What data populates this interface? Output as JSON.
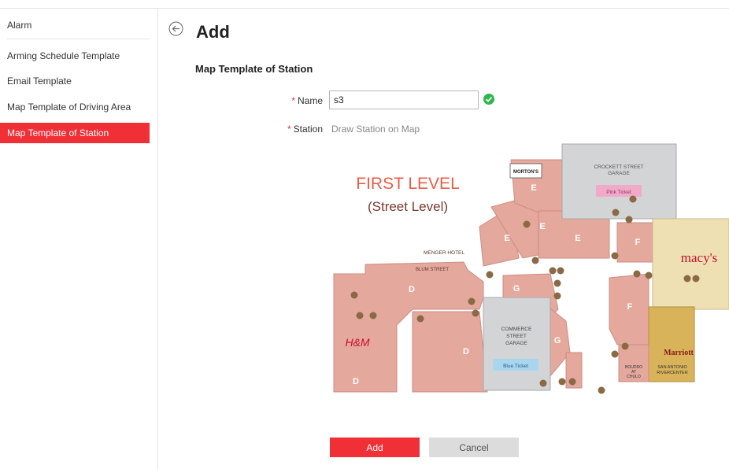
{
  "sidebar": {
    "title": "Alarm",
    "items": [
      {
        "label": "Arming Schedule Template"
      },
      {
        "label": "Email Template"
      },
      {
        "label": "Map Template of Driving Area"
      },
      {
        "label": "Map Template of Station",
        "active": true
      }
    ]
  },
  "header": {
    "title": "Add",
    "back_icon": "back-arrow-icon"
  },
  "form": {
    "section_title": "Map Template of Station",
    "name_label": "Name",
    "name_value": "s3",
    "station_label": "Station",
    "station_hint": "Draw Station on Map",
    "required_mark": "*"
  },
  "map": {
    "first_level": "FIRST LEVEL",
    "street_level": "(Street Level)",
    "mortons": "MORTON'S",
    "crockett": [
      "CROCKETT STREET",
      "GARAGE"
    ],
    "pink_ticket": "Pink Ticket",
    "macys": "macy's",
    "menger": "MENGER HOTEL",
    "blum": "BLUM STREET",
    "commerce": [
      "COMMERCE",
      "STREET",
      "GARAGE"
    ],
    "blue_ticket": "Blue Ticket",
    "hm": "H&M",
    "marriott": "Marriott",
    "riverwalk": [
      "SAN ANTONIO",
      "RIVERCENTER"
    ],
    "boudro": [
      "BOUDRO",
      "AT",
      "CHULO"
    ],
    "zone_letters": [
      "E",
      "E",
      "E",
      "E",
      "F",
      "F",
      "G",
      "G",
      "D",
      "D",
      "D"
    ]
  },
  "buttons": {
    "add": "Add",
    "cancel": "Cancel"
  },
  "colors": {
    "accent": "#f12f37",
    "valid": "#2db84d"
  }
}
